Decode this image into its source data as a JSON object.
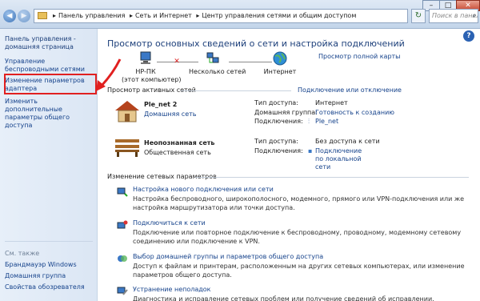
{
  "titlebar": {
    "breadcrumb": [
      "Панель управления",
      "Сеть и Интернет",
      "Центр управления сетями и общим доступом"
    ],
    "search_placeholder": "Поиск в панели управления",
    "back": "◀",
    "forward": "▶"
  },
  "left": {
    "home": "Панель управления - домашняя страница",
    "wireless": "Управление беспроводными сетями",
    "adapter": "Изменение параметров адаптера",
    "sharing": "Изменить дополнительные параметры общего доступа",
    "see_also": "См. также",
    "firewall": "Брандмауэр Windows",
    "homegroup": "Домашняя группа",
    "browser": "Свойства обозревателя"
  },
  "main": {
    "title": "Просмотр основных сведений о сети и настройка подключений",
    "full_map": "Просмотр полной карты",
    "map": [
      {
        "label": "HP-ПК",
        "sub": "(этот компьютер)"
      },
      {
        "label": "Несколько сетей",
        "sub": ""
      },
      {
        "label": "Интернет",
        "sub": ""
      }
    ],
    "active_header": "Просмотр активных сетей",
    "connect_disconnect": "Подключение или отключение",
    "networks": [
      {
        "name": "Ple_net  2",
        "type": "Домашняя сеть",
        "access_k": "Тип доступа:",
        "access_v": "Интернет",
        "group_k": "Домашняя группа:",
        "group_v": "Готовность к созданию",
        "conn_k": "Подключения:",
        "conn_v": "Ple_net"
      },
      {
        "name": "Неопознанная сеть",
        "type": "Общественная сеть",
        "access_k": "Тип доступа:",
        "access_v": "Без доступа к сети",
        "conn_k": "Подключения:",
        "conn_v": "Подключение по локальной сети"
      }
    ],
    "change_header": "Изменение сетевых параметров",
    "tasks": [
      {
        "title": "Настройка нового подключения или сети",
        "desc": "Настройка беспроводного, широкополосного, модемного, прямого или VPN-подключения или же настройка маршрутизатора или точки доступа."
      },
      {
        "title": "Подключиться к сети",
        "desc": "Подключение или повторное подключение к беспроводному, проводному, модемному сетевому соединению или подключение к VPN."
      },
      {
        "title": "Выбор домашней группы и параметров общего доступа",
        "desc": "Доступ к файлам и принтерам, расположенным на других сетевых компьютерах, или изменение параметров общего доступа."
      },
      {
        "title": "Устранение неполадок",
        "desc": "Диагностика и исправление сетевых проблем или получение сведений об исправлении."
      }
    ],
    "help": "?"
  },
  "colors": {
    "link": "#15428b",
    "highlight": "#e12020"
  }
}
